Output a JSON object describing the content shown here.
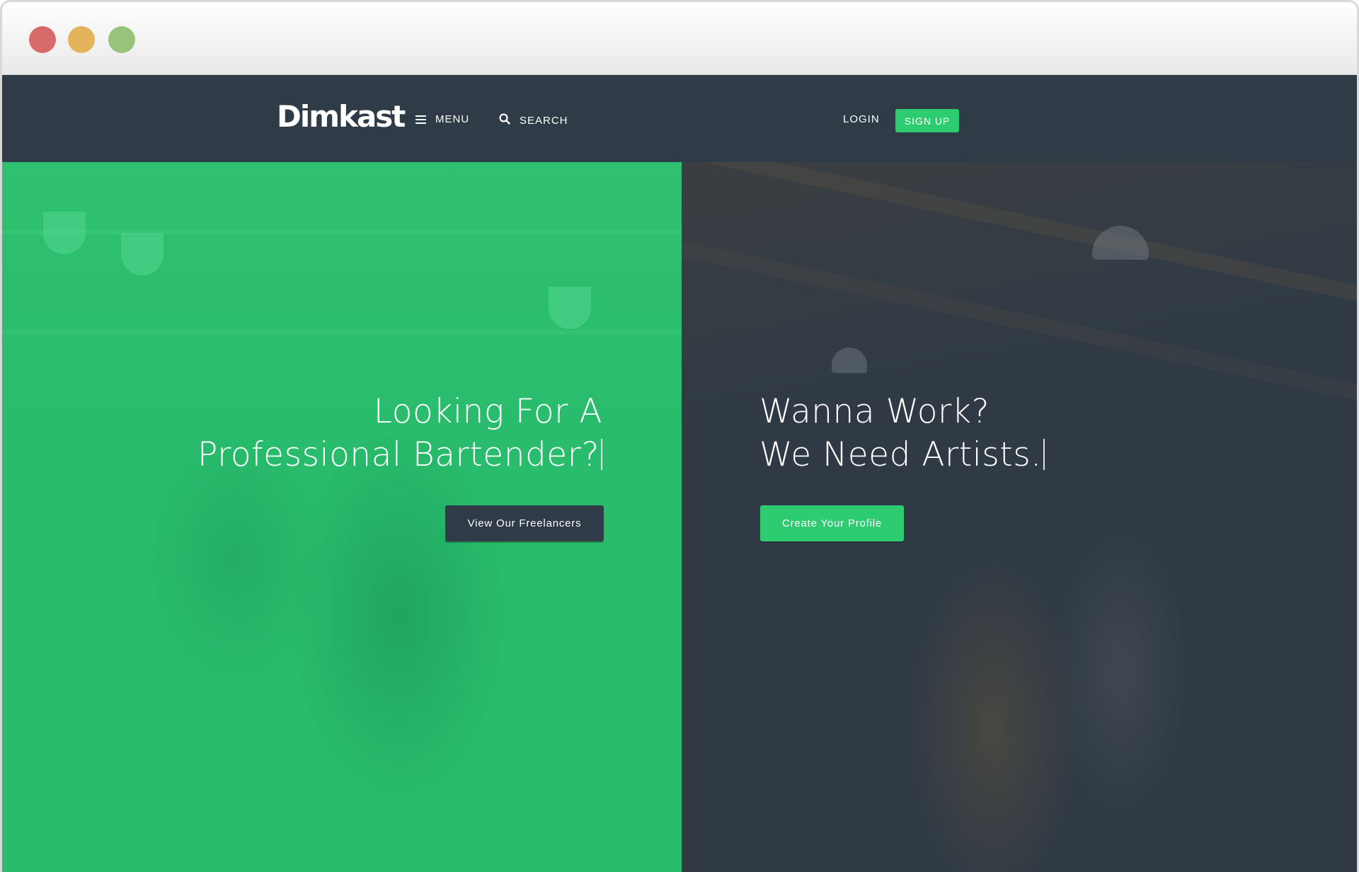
{
  "window": {
    "controls": [
      "close",
      "minimize",
      "zoom"
    ],
    "control_colors": {
      "close": "#d96a6a",
      "minimize": "#e5b35c",
      "zoom": "#97c47a"
    }
  },
  "header": {
    "logo": "Dimkast",
    "menu_label": "MENU",
    "menu_icon": "hamburger-icon",
    "search_label": "SEARCH",
    "search_icon": "search-icon",
    "login_label": "LOGIN",
    "signup_label": "SIGN UP",
    "background_color": "#2f3c47",
    "accent_color": "#2ecc71"
  },
  "hero": {
    "left": {
      "heading_line1": "Looking For A",
      "heading_line2": "Professional Bartender?",
      "button_label": "View Our Freelancers",
      "overlay_color": "#28bc6c"
    },
    "right": {
      "heading_line1": "Wanna Work?",
      "heading_line2": "We Need Artists.",
      "button_label": "Create Your Profile",
      "overlay_color": "#2f3a45"
    }
  }
}
